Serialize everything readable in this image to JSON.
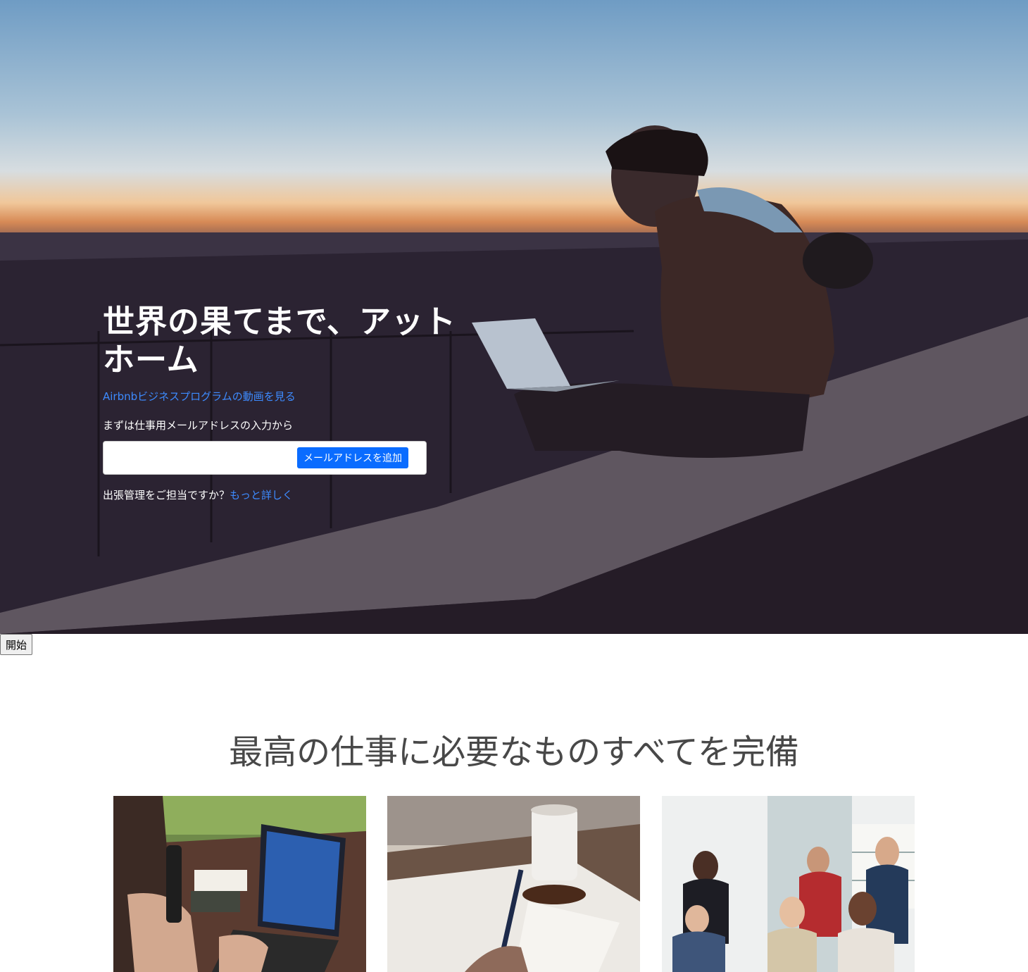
{
  "hero": {
    "title": "世界の果てまで、アットホーム",
    "video_link": "Airbnbビジネスプログラムの動画を見る",
    "email_intro": "まずは仕事用メールアドレスの入力から",
    "email_input": {
      "value": "",
      "placeholder": ""
    },
    "email_button": "メールアドレスを追加",
    "manager_question": "出張管理をご担当ですか？",
    "manager_link": "もっと詳しく"
  },
  "start_button": "開始",
  "features": {
    "title": "最高の仕事に必要なものすべてを完備",
    "cards": [
      {
        "image": "person-typing-on-laptop-outdoors"
      },
      {
        "image": "hand-writing-notes-with-coffee"
      },
      {
        "image": "team-meeting-in-office"
      }
    ]
  }
}
